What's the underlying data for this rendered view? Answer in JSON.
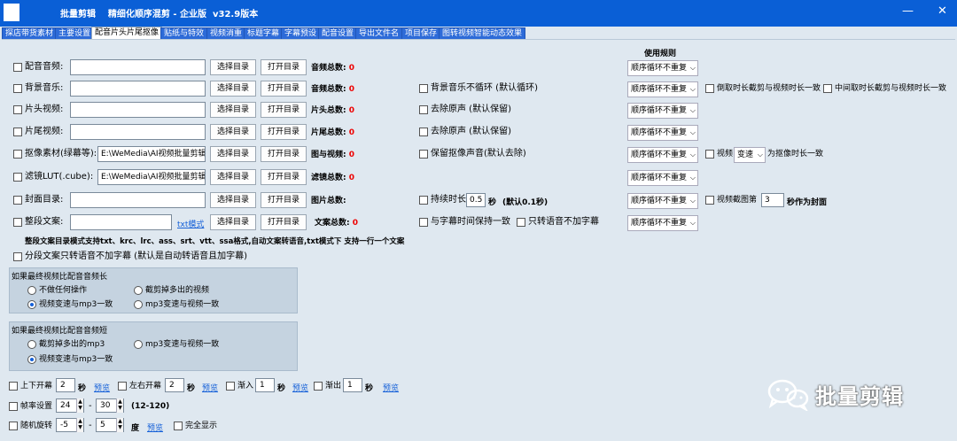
{
  "app": {
    "title": "批量剪辑    精细化顺序混剪 - 企业版  v32.9版本",
    "minimize": "—",
    "close": "✕"
  },
  "tabs": [
    "探店带货素材",
    "主要设置",
    "配音片头片尾抠像",
    "贴纸与特效",
    "视频消重",
    "标题字幕",
    "字幕预设",
    "配音设置",
    "导出文件名",
    "项目保存",
    "图转视频智能动态效果"
  ],
  "active_tab": 2,
  "rules_header": "使用规则",
  "rows": [
    {
      "label": "配音音频:",
      "path": "",
      "select_dir": "选择目录",
      "open_dir": "打开目录",
      "count_label": "音频总数:",
      "count": "0",
      "rule": "顺序循环不重复"
    },
    {
      "label": "背景音乐:",
      "path": "",
      "select_dir": "选择目录",
      "open_dir": "打开目录",
      "count_label": "音频总数:",
      "count": "0",
      "rule": "顺序循环不重复",
      "option": "背景音乐不循环 (默认循环)",
      "extra1": "倒取时长截剪与视频时长一致",
      "extra2": "中间取时长截剪与视频时长一致"
    },
    {
      "label": "片头视频:",
      "path": "",
      "select_dir": "选择目录",
      "open_dir": "打开目录",
      "count_label": "片头总数:",
      "count": "0",
      "rule": "顺序循环不重复",
      "option": "去除原声 (默认保留)"
    },
    {
      "label": "片尾视频:",
      "path": "",
      "select_dir": "选择目录",
      "open_dir": "打开目录",
      "count_label": "片尾总数:",
      "count": "0",
      "rule": "顺序循环不重复",
      "option": "去除原声 (默认保留)"
    },
    {
      "label": "抠像素材(绿幕等):",
      "path": "E:\\WeMedia\\AI视频批量剪辑",
      "select_dir": "选择目录",
      "open_dir": "打开目录",
      "count_label": "图与视频:",
      "count": "0",
      "rule": "顺序循环不重复",
      "option": "保留抠像声音(默认去除)",
      "extra_video": "视频",
      "extra_speed": "变速",
      "extra_suffix": "为抠像时长一致"
    },
    {
      "label": "滤镜LUT(.cube):",
      "path": "E:\\WeMedia\\AI视频批量剪辑",
      "select_dir": "选择目录",
      "open_dir": "打开目录",
      "count_label": "滤镜总数:",
      "count": "0",
      "rule": "顺序循环不重复"
    },
    {
      "label": "封面目录:",
      "path": "",
      "select_dir": "选择目录",
      "open_dir": "打开目录",
      "count_label": "图片总数:",
      "count": "",
      "rule": "顺序循环不重复",
      "option": "持续时长",
      "duration": "0.5",
      "duration_unit": "秒",
      "duration_note": "(默认0.1秒)",
      "extra_video_cover": "视频截图第",
      "cover_sec": "3",
      "cover_suffix": "秒作为封面"
    },
    {
      "label": "整段文案:",
      "path": "",
      "txt_link": "txt模式",
      "select_dir": "选择目录",
      "open_dir": "打开目录",
      "count_label": "文案总数:",
      "count": "0",
      "rule": "顺序循环不重复",
      "option": "与字幕时间保持一致",
      "option2": "只转语音不加字幕"
    }
  ],
  "text_note": "整段文案目录模式支持txt、krc、lrc、ass、srt、vtt、ssa格式,自动文案转语音,txt模式下 支持一行一个文案",
  "split_option": "分段文案只转语音不加字幕 (默认是自动转语音且加字幕)",
  "group_longer": {
    "title": "如果最终视频比配音音频长",
    "options": [
      "不做任何操作",
      "截剪掉多出的视频",
      "视频变速与mp3一致",
      "mp3变速与视频一致"
    ],
    "selected": 2
  },
  "group_shorter": {
    "title": "如果最终视频比配音音频短",
    "options": [
      "截剪掉多出的mp3",
      "mp3变速与视频一致",
      "视频变速与mp3一致"
    ],
    "selected": 2
  },
  "bottom": {
    "open_close_v": {
      "label": "上下开幕",
      "value": "2",
      "unit": "秒",
      "link": "预览"
    },
    "open_close_h": {
      "label": "左右开幕",
      "value": "2",
      "unit": "秒",
      "link": "预览"
    },
    "fade_in": {
      "label": "渐入",
      "value": "1",
      "unit": "秒",
      "link": "预览"
    },
    "fade_out": {
      "label": "渐出",
      "value": "1",
      "unit": "秒",
      "link": "预览"
    },
    "fps": {
      "label": "帧率设置",
      "min": "24",
      "dash": "-",
      "max": "30",
      "range_note": "(12-120)"
    },
    "rotate": {
      "label": "随机旋转",
      "min": "-5",
      "dash": "-",
      "max": "5",
      "unit": "度",
      "link": "预览",
      "full_label": "完全显示"
    }
  },
  "watermark": "批量剪辑"
}
